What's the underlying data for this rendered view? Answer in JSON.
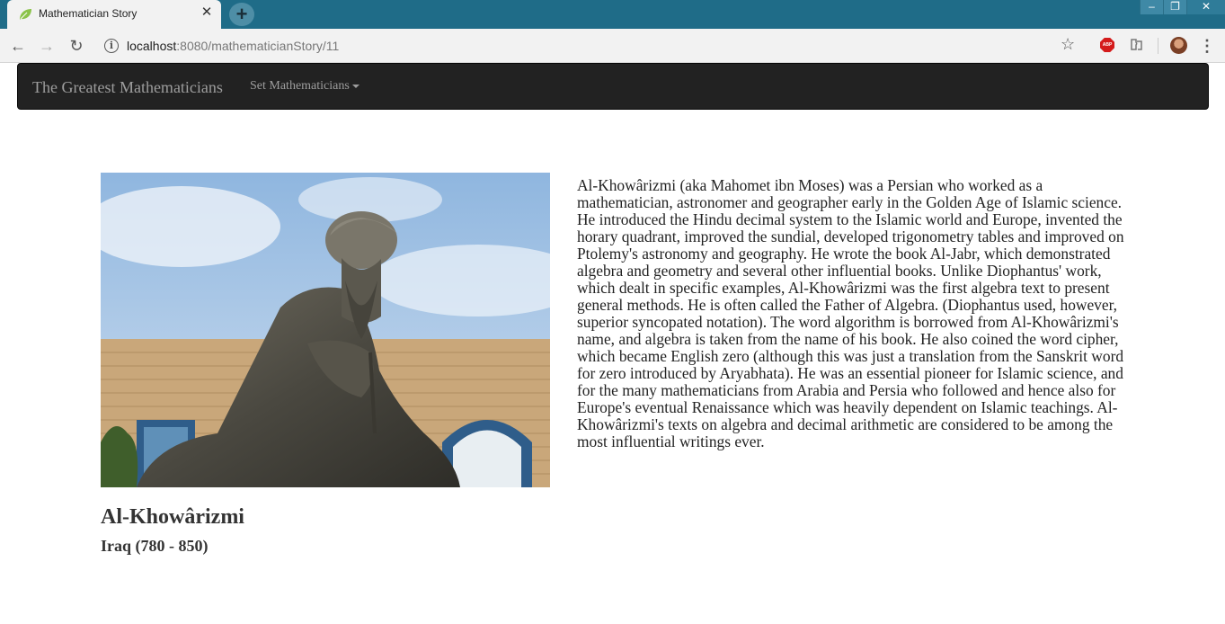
{
  "browser": {
    "tab_title": "Mathematician Story",
    "url_host": "localhost",
    "url_rest": ":8080/mathematicianStory/11",
    "icons": [
      "leaf-favicon-icon",
      "close-icon",
      "plus-icon",
      "back-arrow-icon",
      "forward-arrow-icon",
      "reload-icon",
      "info-icon",
      "star-icon",
      "adblock-icon",
      "extension-icon",
      "profile-avatar",
      "more-menu-icon"
    ]
  },
  "navbar": {
    "brand": "The Greatest Mathematicians",
    "dropdown_label": "Set Mathematicians"
  },
  "mathematician": {
    "name": "Al-Khowârizmi",
    "origin": "Iraq (780 - 850)",
    "story": "Al-Khowârizmi (aka Mahomet ibn Moses) was a Persian who worked as a mathematician, astronomer and geographer early in the Golden Age of Islamic science. He introduced the Hindu decimal system to the Islamic world and Europe, invented the horary quadrant, improved the sundial, developed trigonometry tables and improved on Ptolemy's astronomy and geography. He wrote the book Al-Jabr, which demonstrated algebra and geometry and several other influential books. Unlike Diophantus' work, which dealt in specific examples, Al-Khowârizmi was the first algebra text to present general methods. He is often called the Father of Algebra. (Diophantus used, however, superior syncopated notation). The word algorithm is borrowed from Al-Khowârizmi's name, and algebra is taken from the name of his book. He also coined the word cipher, which became English zero (although this was just a translation from the Sanskrit word for zero introduced by Aryabhata). He was an essential pioneer for Islamic science, and for the many mathematicians from Arabia and Persia who followed and hence also for Europe's eventual Renaissance which was heavily dependent on Islamic teachings. Al-Khowârizmi's texts on algebra and decimal arithmetic are considered to be among the most influential writings ever."
  },
  "colors": {
    "titlebar": "#1f6c88",
    "navbar_bg": "#222222",
    "navbar_text": "#9d9d9d",
    "body_text": "#333333"
  }
}
